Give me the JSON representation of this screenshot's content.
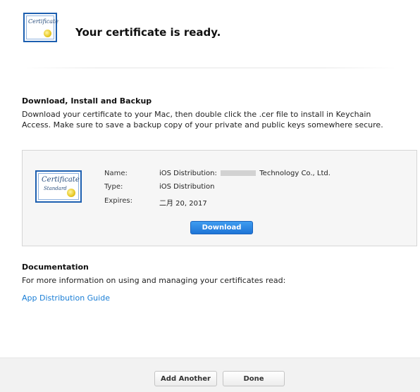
{
  "header": {
    "title": "Your certificate is ready.",
    "icon_script": "Certificate"
  },
  "download_section": {
    "heading": "Download, Install and Backup",
    "text": "Download your certificate to your Mac, then double click the .cer file to install in Keychain Access. Make sure to save a backup copy of your private and public keys somewhere secure."
  },
  "certificate": {
    "icon_script": "Certificate",
    "icon_sub": "Standard",
    "name_label": "Name:",
    "name_prefix": "iOS Distribution: ",
    "name_suffix": " Technology Co., Ltd.",
    "type_label": "Type:",
    "type_value": "iOS Distribution",
    "expires_label": "Expires:",
    "expires_value": "二月 20, 2017",
    "download_label": "Download"
  },
  "documentation": {
    "heading": "Documentation",
    "text": "For more information on using and managing your certificates read:",
    "link_label": "App Distribution Guide"
  },
  "footer": {
    "add_another_label": "Add Another",
    "done_label": "Done"
  },
  "colors": {
    "accent": "#1e74d6",
    "link": "#1a7ed6",
    "certificate_border": "#1d5fb0",
    "seal": "#e8c822"
  }
}
